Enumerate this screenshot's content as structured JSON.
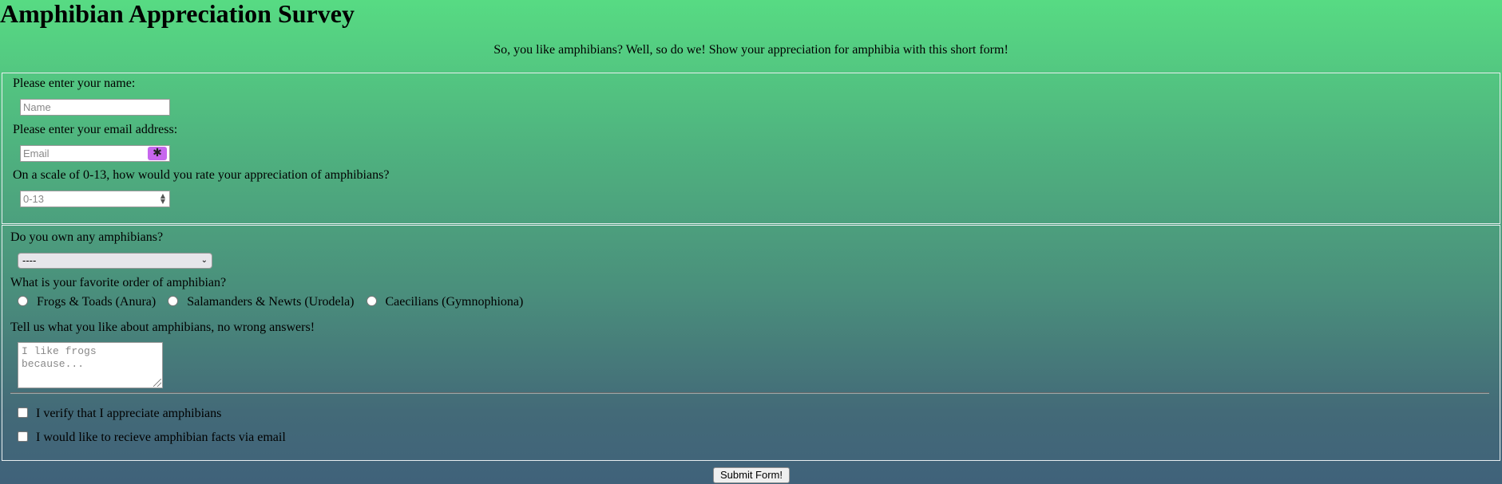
{
  "page": {
    "title": "Amphibian Appreciation Survey",
    "description": "So, you like amphibians? Well, so do we! Show your appreciation for amphibia with this short form!"
  },
  "section1": {
    "name_label": "Please enter your name:",
    "name_placeholder": "Name",
    "email_label": "Please enter your email address:",
    "email_placeholder": "Email",
    "rating_label": "On a scale of 0-13, how would you rate your appreciation of amphibians?",
    "rating_placeholder": "0-13"
  },
  "section2": {
    "own_label": "Do you own any amphibians?",
    "own_selected": "----",
    "order_label": "What is your favorite order of amphibian?",
    "order_options": [
      "Frogs & Toads (Anura)",
      "Salamanders & Newts (Urodela)",
      "Caecilians (Gymnophiona)"
    ],
    "comments_label": "Tell us what you like about amphibians, no wrong answers!",
    "comments_placeholder": "I like frogs because...",
    "checkboxes": [
      "I verify that I appreciate amphibians",
      "I would like to recieve amphibian facts via email"
    ]
  },
  "submit_label": "Submit Form!",
  "icons": {
    "email_helper": "password-manager-icon",
    "spinner": "number-spinner-icon",
    "select_arrow": "chevron-down-icon"
  }
}
